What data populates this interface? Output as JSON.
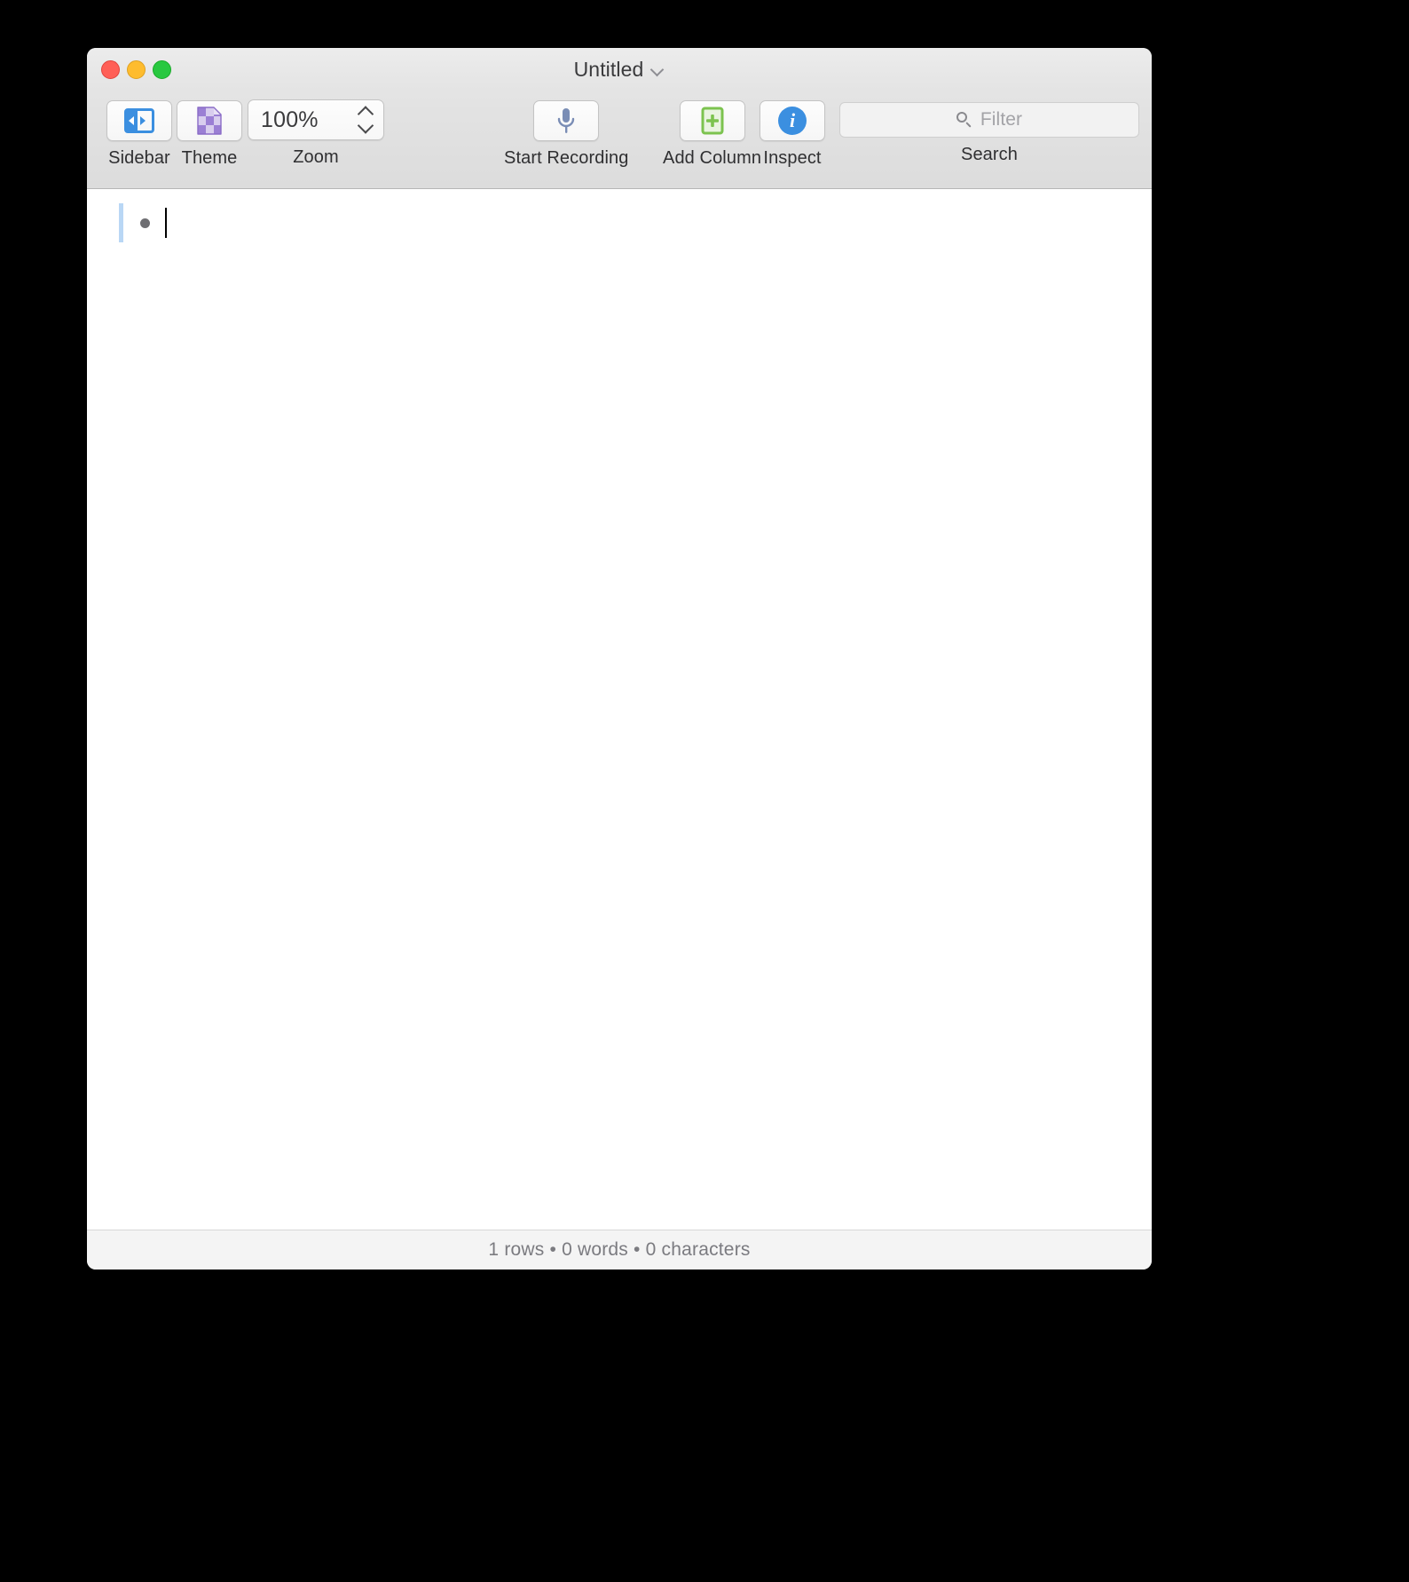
{
  "window": {
    "title": "Untitled",
    "title_chevron_icon": "chevron-down-icon",
    "traffic_lights": {
      "close_color": "#ff5f57",
      "minimize_color": "#febc2e",
      "maximize_color": "#28c840"
    }
  },
  "toolbar": {
    "items": [
      {
        "label": "Sidebar",
        "icon": "sidebar-toggle-icon"
      },
      {
        "label": "Theme",
        "icon": "theme-document-icon"
      },
      {
        "label": "Zoom",
        "icon": "zoom-stepper-icon"
      },
      {
        "label": "Start Recording",
        "icon": "microphone-icon"
      },
      {
        "label": "Add Column",
        "icon": "add-column-icon"
      },
      {
        "label": "Inspect",
        "icon": "info-circle-icon"
      },
      {
        "label": "Search",
        "icon": "search-icon"
      }
    ],
    "zoom": {
      "value": "100%",
      "stepper_up_icon": "chevron-up-icon",
      "stepper_down_icon": "chevron-down-icon"
    },
    "search": {
      "placeholder": "Filter",
      "value": "",
      "label": "Search",
      "icon": "magnifying-glass-icon"
    }
  },
  "content": {
    "rows": [
      {
        "bullet": "•",
        "text": ""
      }
    ]
  },
  "statusbar": {
    "text": "1 rows • 0 words • 0 characters",
    "rows_count": "1 rows",
    "words_count": "0 words",
    "characters_count": "0 characters"
  },
  "colors": {
    "accent_blue": "#3b8fe0",
    "theme_purple": "#9b7fd4",
    "add_column_green": "#7cc34f",
    "row_indicator_blue": "#b9d7f5",
    "mic_blue_gray": "#7a8db5"
  }
}
